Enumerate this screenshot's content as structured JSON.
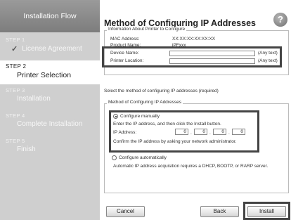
{
  "sidebar": {
    "header": "Installation Flow",
    "steps": [
      {
        "num": "STEP 1",
        "title": "License Agreement"
      },
      {
        "num": "STEP 2",
        "title": "Printer Selection"
      },
      {
        "num": "STEP 3",
        "title": "Installation"
      },
      {
        "num": "STEP 4",
        "title": "Complete Installation"
      },
      {
        "num": "STEP 5",
        "title": "Finish"
      }
    ]
  },
  "main": {
    "title": "Method of Configuring IP Addresses",
    "help_glyph": "?",
    "info": {
      "legend": "Information About Printer to Configure",
      "mac_label": "MAC Address:",
      "mac_value": "XX:XX:XX:XX:XX:XX",
      "product_label": "Product Name:",
      "product_value": "iPFxxx",
      "device_label": "Device Name:",
      "device_value": "",
      "device_hint": "(Any text)",
      "location_label": "Printer Location:",
      "location_value": "",
      "location_hint": "(Any text)"
    },
    "select_text": "Select the method of configuring IP addresses (required)",
    "method": {
      "legend": "Method of Configuring IP Addresses",
      "manual_label": "Configure manually",
      "manual_desc": "Enter the IP address, and then click the Install button.",
      "ip_label": "IP Address:",
      "ip_octets": [
        "0",
        "0",
        "0",
        "0"
      ],
      "confirm_text": "Confirm the IP address by asking your network administrator.",
      "auto_label": "Configure automatically",
      "auto_desc": "Automatic IP address acquisition requires a DHCP, BOOTP, or RARP server."
    }
  },
  "buttons": {
    "cancel": "Cancel",
    "back": "Back",
    "install": "Install"
  }
}
